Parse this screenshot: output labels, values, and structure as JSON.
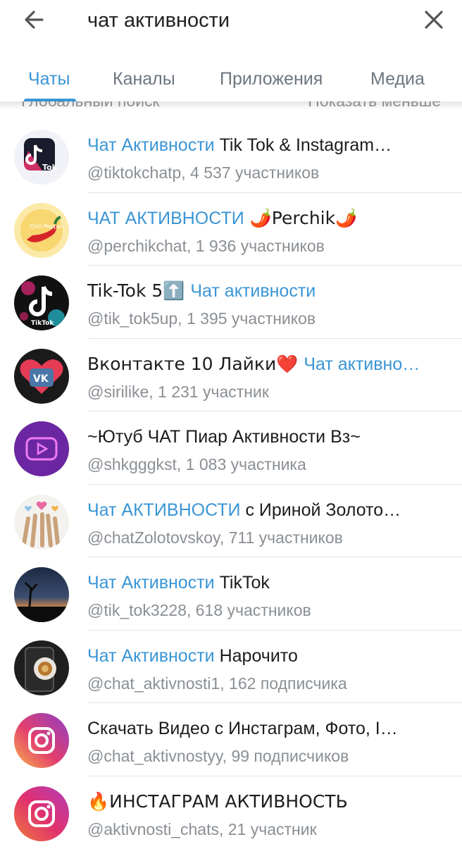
{
  "search": {
    "query": "чат активности",
    "back_icon": "arrow-left-icon",
    "clear_icon": "close-icon"
  },
  "tabs": [
    {
      "label": "Чаты",
      "active": true
    },
    {
      "label": "Каналы",
      "active": false
    },
    {
      "label": "Приложения",
      "active": false
    },
    {
      "label": "Медиа",
      "active": false
    }
  ],
  "section": {
    "title": "Глобальный поиск",
    "action": "Показать меньше"
  },
  "colors": {
    "accent": "#3a95d5",
    "secondary_text": "#8a8f94"
  },
  "results": [
    {
      "highlight": "Чат Активности",
      "rest": " Tik Tok & Instagram…",
      "subtitle": "@tiktokchatp, 4 537 участников",
      "avatar": "tiktok-logo-avatar"
    },
    {
      "highlight": "ЧАТ АКТИВНОСТИ",
      "rest": " 🌶️Perchik🌶️",
      "subtitle": "@perchikchat, 1 936 участников",
      "avatar": "chili-pepper-avatar"
    },
    {
      "prefix": "Tik-Tok 5⬆️ ",
      "highlight": "Чат активности",
      "rest": "",
      "subtitle": "@tik_tok5up, 1 395 участников",
      "avatar": "tiktok-neon-avatar"
    },
    {
      "prefix": "Вконтакте 10 Лайки❤️ ",
      "highlight": "Чат активно…",
      "rest": "",
      "subtitle": "@sirilike, 1 231 участник",
      "avatar": "vk-heart-avatar"
    },
    {
      "prefix": "~Ютуб ЧАТ Пиар Активности Вз~",
      "highlight": "",
      "rest": "",
      "subtitle": "@shkgggkst, 1 083 участника",
      "avatar": "youtube-neon-avatar"
    },
    {
      "highlight": "Чат АКТИВНОСТИ",
      "rest": " с Ириной Золото…",
      "subtitle": "@chatZolotovskoy, 711 участников",
      "avatar": "hands-hearts-avatar"
    },
    {
      "highlight": "Чат Активности",
      "rest": " TikTok",
      "subtitle": "@tik_tok3228, 618 участников",
      "avatar": "sunset-tree-avatar"
    },
    {
      "highlight": "Чат Активности",
      "rest": " Нарочито",
      "subtitle": "@chat_aktivnosti1, 162 подписчика",
      "avatar": "phone-coffee-avatar"
    },
    {
      "prefix": "Скачать Видео с Инстаграм, Фото, I…",
      "highlight": "",
      "rest": "",
      "subtitle": "@chat_aktivnostyy, 99 подписчиков",
      "avatar": "instagram-logo-avatar"
    },
    {
      "prefix": "🔥ИНСТАГРАМ АКТИВНОСТЬ",
      "highlight": "",
      "rest": "",
      "subtitle": "@aktivnosti_chats, 21 участник",
      "avatar": "instagram-logo-avatar"
    }
  ]
}
